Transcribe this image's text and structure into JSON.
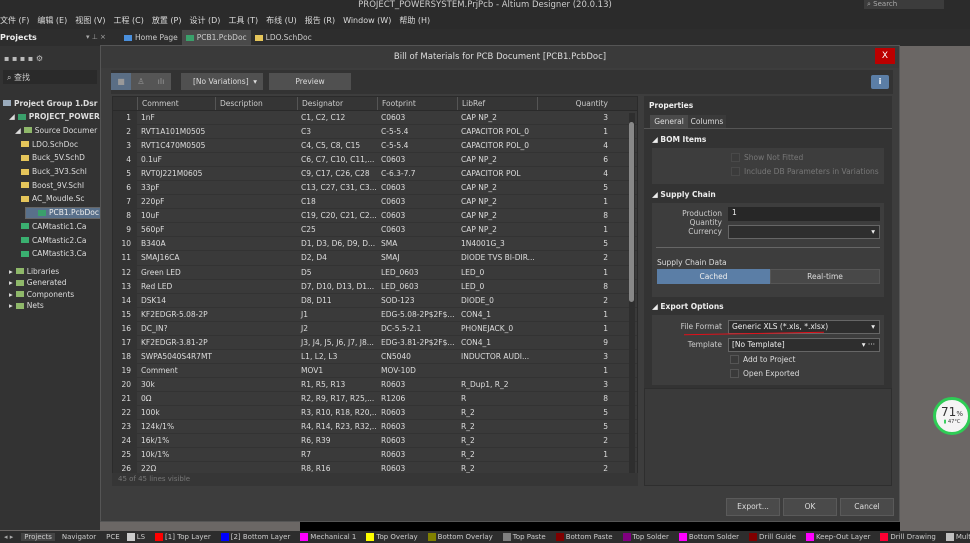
{
  "app": {
    "title": "PROJECT_POWERSYSTEM.PrjPcb - Altium Designer (20.0.13)",
    "search_placeholder": "Search"
  },
  "menu": [
    "文件 (F)",
    "编辑 (E)",
    "视图 (V)",
    "工程 (C)",
    "放置 (P)",
    "设计 (D)",
    "工具 (T)",
    "布线 (U)",
    "报告 (R)",
    "Window (W)",
    "帮助 (H)"
  ],
  "projects_panel": {
    "title": "Projects",
    "search": "查找",
    "tree": [
      {
        "label": "Project Group 1.Dsr",
        "level": 0,
        "icon": "project-group-icon"
      },
      {
        "label": "PROJECT_POWER",
        "level": 1,
        "icon": "pcb-project-icon",
        "bold": true
      },
      {
        "label": "Source Documer",
        "level": 2,
        "icon": "folder-icon"
      },
      {
        "label": "LDO.SchDoc",
        "level": 3,
        "icon": "schematic-icon"
      },
      {
        "label": "Buck_5V.SchD",
        "level": 3,
        "icon": "schematic-icon"
      },
      {
        "label": "Buck_3V3.Schl",
        "level": 3,
        "icon": "schematic-icon"
      },
      {
        "label": "Boost_9V.SchI",
        "level": 3,
        "icon": "schematic-icon"
      },
      {
        "label": "AC_Moudle.Sc",
        "level": 3,
        "icon": "schematic-icon"
      },
      {
        "label": "PCB1.PcbDoc",
        "level": 3,
        "icon": "pcb-icon",
        "selected": true
      },
      {
        "label": "CAMtastic1.Ca",
        "level": 3,
        "icon": "cam-icon"
      },
      {
        "label": "CAMtastic2.Ca",
        "level": 3,
        "icon": "cam-icon"
      },
      {
        "label": "CAMtastic3.Ca",
        "level": 3,
        "icon": "cam-icon"
      },
      {
        "label": "Libraries",
        "level": 1,
        "icon": "folder-icon"
      },
      {
        "label": "Generated",
        "level": 1,
        "icon": "folder-icon"
      },
      {
        "label": "Components",
        "level": 1,
        "icon": "folder-icon"
      },
      {
        "label": "Nets",
        "level": 1,
        "icon": "folder-icon"
      }
    ]
  },
  "doc_tabs": [
    {
      "label": "Home Page"
    },
    {
      "label": "PCB1.PcbDoc",
      "active": true
    },
    {
      "label": "LDO.SchDoc"
    }
  ],
  "dialog": {
    "title": "Bill of Materials for PCB Document [PCB1.PcbDoc]",
    "close": "X",
    "variations": "[No Variations]",
    "preview": "Preview",
    "info": "i",
    "columns": [
      "",
      "Comment",
      "Description",
      "Designator",
      "Footprint",
      "LibRef",
      "Quantity"
    ],
    "rows": [
      [
        "1",
        "1nF",
        "",
        "C1, C2, C12",
        "C0603",
        "CAP NP_2",
        "3"
      ],
      [
        "2",
        "RVT1A101M0505",
        "",
        "C3",
        "C-5-5.4",
        "CAPACITOR POL_0",
        "1"
      ],
      [
        "3",
        "RVT1C470M0505",
        "",
        "C4, C5, C8, C15",
        "C-5-5.4",
        "CAPACITOR POL_0",
        "4"
      ],
      [
        "4",
        "0.1uF",
        "",
        "C6, C7, C10, C11,...",
        "C0603",
        "CAP NP_2",
        "6"
      ],
      [
        "5",
        "RVT0J221M0605",
        "",
        "C9, C17, C26, C28",
        "C-6.3-7.7",
        "CAPACITOR POL",
        "4"
      ],
      [
        "6",
        "33pF",
        "",
        "C13, C27, C31, C3...",
        "C0603",
        "CAP NP_2",
        "5"
      ],
      [
        "7",
        "220pF",
        "",
        "C18",
        "C0603",
        "CAP NP_2",
        "1"
      ],
      [
        "8",
        "10uF",
        "",
        "C19, C20, C21, C2...",
        "C0603",
        "CAP NP_2",
        "8"
      ],
      [
        "9",
        "560pF",
        "",
        "C25",
        "C0603",
        "CAP NP_2",
        "1"
      ],
      [
        "10",
        "B340A",
        "",
        "D1, D3, D6, D9, D...",
        "SMA",
        "1N4001G_3",
        "5"
      ],
      [
        "11",
        "SMAJ16CA",
        "",
        "D2, D4",
        "SMAJ",
        "DIODE TVS BI-DIR...",
        "2"
      ],
      [
        "12",
        "Green LED",
        "",
        "D5",
        "LED_0603",
        "LED_0",
        "1"
      ],
      [
        "13",
        "Red LED",
        "",
        "D7, D10, D13, D1...",
        "LED_0603",
        "LED_0",
        "8"
      ],
      [
        "14",
        "DSK14",
        "",
        "D8, D11",
        "SOD-123",
        "DIODE_0",
        "2"
      ],
      [
        "15",
        "KF2EDGR-5.08-2P",
        "",
        "J1",
        "EDG-5.08-2P$2F$...",
        "CON4_1",
        "1"
      ],
      [
        "16",
        "DC_IN?",
        "",
        "J2",
        "DC-5.5-2.1",
        "PHONEJACK_0",
        "1"
      ],
      [
        "17",
        "KF2EDGR-3.81-2P",
        "",
        "J3, J4, J5, J6, J7, J8...",
        "EDG-3.81-2P$2F$...",
        "CON4_1",
        "9"
      ],
      [
        "18",
        "SWPA5040S4R7MT",
        "",
        "L1, L2, L3",
        "CN5040",
        "INDUCTOR AUDI...",
        "3"
      ],
      [
        "19",
        "Comment",
        "",
        "MOV1",
        "MOV-10D",
        "",
        "1"
      ],
      [
        "20",
        "30k",
        "",
        "R1, R5, R13",
        "R0603",
        "R_Dup1, R_2",
        "3"
      ],
      [
        "21",
        "0Ω",
        "",
        "R2, R9, R17, R25,...",
        "R1206",
        "R",
        "8"
      ],
      [
        "22",
        "100k",
        "",
        "R3, R10, R18, R20,...",
        "R0603",
        "R_2",
        "5"
      ],
      [
        "23",
        "124k/1%",
        "",
        "R4, R14, R23, R32,...",
        "R0603",
        "R_2",
        "5"
      ],
      [
        "24",
        "16k/1%",
        "",
        "R6, R39",
        "R0603",
        "R_2",
        "2"
      ],
      [
        "25",
        "10k/1%",
        "",
        "R7",
        "R0603",
        "R_2",
        "1"
      ],
      [
        "26",
        "22Ω",
        "",
        "R8, R16",
        "R0603",
        "R_2",
        "2"
      ]
    ],
    "footer": "45 of 45 lines visible",
    "properties": {
      "title": "Properties",
      "tabs": [
        "General",
        "Columns"
      ],
      "bom_items": {
        "title": "BOM Items",
        "show_not_fitted": "Show Not Fitted",
        "include_db": "Include DB Parameters in Variations"
      },
      "supply_chain": {
        "title": "Supply Chain",
        "production_quantity_label": "Production Quantity",
        "production_quantity": "1",
        "currency_label": "Currency",
        "currency": "",
        "data_label": "Supply Chain Data",
        "cached": "Cached",
        "realtime": "Real-time",
        "selected": "Cached"
      },
      "export_options": {
        "title": "Export Options",
        "file_format_label": "File Format",
        "file_format": "Generic XLS (*.xls, *.xlsx)",
        "template_label": "Template",
        "template": "[No Template]",
        "add_to_project": "Add to Project",
        "open_exported": "Open Exported"
      }
    },
    "buttons": {
      "export": "Export...",
      "ok": "OK",
      "cancel": "Cancel"
    }
  },
  "gauge": {
    "percent": "71",
    "unit": "%",
    "temp": "47°C"
  },
  "status_bar": {
    "tabs": [
      "Projects",
      "Navigator",
      "PCE"
    ],
    "layers": [
      {
        "label": "LS",
        "color": "#cccccc"
      },
      {
        "label": "[1] Top Layer",
        "color": "#ff0000"
      },
      {
        "label": "[2] Bottom Layer",
        "color": "#0000ff"
      },
      {
        "label": "Mechanical 1",
        "color": "#ff00ff"
      },
      {
        "label": "Top Overlay",
        "color": "#ffff00"
      },
      {
        "label": "Bottom Overlay",
        "color": "#808000"
      },
      {
        "label": "Top Paste",
        "color": "#808080"
      },
      {
        "label": "Bottom Paste",
        "color": "#800000"
      },
      {
        "label": "Top Solder",
        "color": "#800080"
      },
      {
        "label": "Bottom Solder",
        "color": "#ff00ff"
      },
      {
        "label": "Drill Guide",
        "color": "#800000"
      },
      {
        "label": "Keep-Out Layer",
        "color": "#ff00ff"
      },
      {
        "label": "Drill Drawing",
        "color": "#ff0033"
      },
      {
        "label": "Multi-La",
        "color": "#c0c0c0"
      }
    ]
  }
}
